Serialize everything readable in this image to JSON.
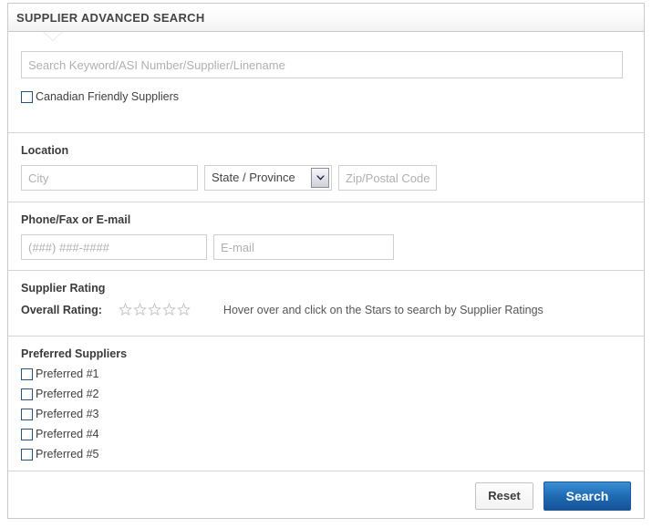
{
  "header": {
    "title": "SUPPLIER ADVANCED SEARCH"
  },
  "keyword_section": {
    "search_placeholder": "Search Keyword/ASI Number/Supplier/Linename",
    "search_value": "",
    "canadian_label": "Canadian Friendly Suppliers"
  },
  "location_section": {
    "label": "Location",
    "city_placeholder": "City",
    "city_value": "",
    "state_selected": "State / Province",
    "state_icon": "chevron-down-icon",
    "zip_placeholder": "Zip/Postal Code",
    "zip_value": ""
  },
  "contact_section": {
    "label": "Phone/Fax or E-mail",
    "phone_placeholder": "(###) ###-####",
    "phone_value": "",
    "email_placeholder": "E-mail",
    "email_value": ""
  },
  "rating_section": {
    "label": "Supplier Rating",
    "overall_label": "Overall Rating:",
    "stars_total": 5,
    "stars_filled": 0,
    "star_icon": "star-outline-icon",
    "hint": "Hover over and click on the Stars to search by Supplier Ratings"
  },
  "preferred_section": {
    "label": "Preferred Suppliers",
    "items": [
      {
        "label": "Preferred #1",
        "checked": false
      },
      {
        "label": "Preferred #2",
        "checked": false
      },
      {
        "label": "Preferred #3",
        "checked": false
      },
      {
        "label": "Preferred #4",
        "checked": false
      },
      {
        "label": "Preferred #5",
        "checked": false
      }
    ]
  },
  "footer": {
    "reset_label": "Reset",
    "search_label": "Search"
  },
  "colors": {
    "accent_blue": "#1f6cb5",
    "checkbox_border": "#2b5278",
    "panel_border": "#c9c9c9",
    "star_outline": "#c8c8c8"
  }
}
